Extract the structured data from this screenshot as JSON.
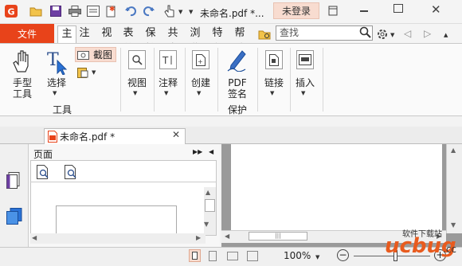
{
  "titlebar": {
    "title": "未命名.pdf *...",
    "login_label": "未登录"
  },
  "menu": {
    "file_label": "文件",
    "tabs": [
      "主页",
      "注释",
      "视图",
      "表单",
      "保护",
      "共享",
      "浏览",
      "特色",
      "帮助"
    ],
    "search_placeholder": "查找"
  },
  "ribbon": {
    "hand_tool_line1": "手型",
    "hand_tool_line2": "工具",
    "select_label": "选择",
    "snapshot_label": "截图",
    "tools_group_label": "工具",
    "view_label": "视图",
    "comment_label": "注释",
    "create_label": "创建",
    "pdf_sign_line1": "PDF",
    "pdf_sign_line2": "签名",
    "protect_group_label": "保护",
    "link_label": "链接",
    "insert_label": "插入"
  },
  "document": {
    "tab_title": "未命名.pdf *"
  },
  "panel": {
    "title": "页面"
  },
  "statusbar": {
    "zoom": "100%"
  },
  "watermark": {
    "site": "软件下载站",
    "logo": "ucbug",
    "tld": ".cc"
  },
  "colors": {
    "accent": "#e8431a",
    "login_bg": "#f8dcd0",
    "doc_bg": "#9a9a9a"
  }
}
